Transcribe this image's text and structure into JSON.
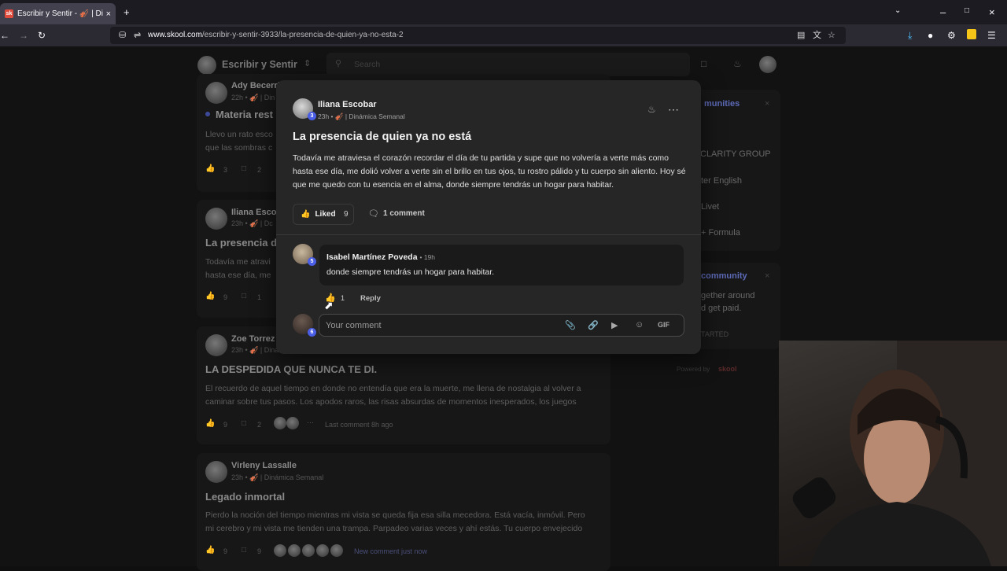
{
  "browser": {
    "tab_title": "Escribir y Sentir - 🎻 | Dinámica",
    "tab_close": "×",
    "new_tab": "+",
    "url_domain": "www.skool.com",
    "url_path": "/escribir-y-sentir-3933/la-presencia-de-quien-ya-no-esta-2"
  },
  "background": {
    "community_name": "Escribir y Sentir",
    "search_placeholder": "Search",
    "posts": [
      {
        "author": "Ady Becerri",
        "meta": "22h • 🎻 | Din",
        "title": "Materia rest",
        "body1": "Llevo un rato esco",
        "body2": "que las sombras c",
        "likes": "3",
        "comments": "2"
      },
      {
        "author": "Iliana Escob",
        "meta": "23h • 🎻 | Dc",
        "title": "La presencia d",
        "body1": "Todavía me atravi",
        "body2": "hasta ese día, me",
        "likes": "9",
        "comments": "1"
      },
      {
        "author": "Zoe Torrez",
        "meta": "23h • 🎻 | Dinámica Semanal",
        "title": "LA DESPEDIDA QUE NUNCA TE DI.",
        "body1": "El recuerdo de aquel tiempo en donde no entendía que era la muerte, me llena de nostalgia al volver a",
        "body2": "caminar sobre tus pasos. Los apodos raros, las risas absurdas de momentos inesperados, los juegos",
        "likes": "9",
        "comments": "2",
        "last": "Last comment 8h ago"
      },
      {
        "author": "Virleny Lassalle",
        "meta": "23h • 🎻 | Dinámica Semanal",
        "title": "Legado inmortal",
        "body1": "Pierdo la noción del tiempo mientras mi vista se queda fija esa silla mecedora. Está vacía, inmóvil. Pero",
        "body2": "mi cerebro y mi vista me tienden una trampa. Parpadeo varias veces y ahí estás. Tu cuerpo envejecido",
        "likes": "9",
        "comments": "9",
        "last": "New comment just now"
      }
    ],
    "sidebar": {
      "heading1": "munities",
      "items": [
        "CLARITY GROUP",
        "ter English",
        "Livet",
        "+ Formula"
      ],
      "heading2": "community",
      "text1": "gether around",
      "text2": "d get paid.",
      "cta": "TARTED",
      "powered": "Powered by"
    }
  },
  "modal": {
    "author": "Iliana Escobar",
    "author_level": "3",
    "meta": "23h • 🎻 | Dinámica Semanal",
    "title": "La presencia de quien ya no está",
    "body": "Todavía me atraviesa el corazón recordar el día de tu partida y supe que no volvería a verte más como hasta ese día, me dolió volver a verte sin el brillo en tus ojos, tu rostro pálido y tu cuerpo sin aliento. Hoy sé que me quedo con tu esencia en el alma, donde siempre tendrás un hogar para habitar.",
    "like_label": "Liked",
    "like_count": "9",
    "comment_count_label": "1 comment",
    "comment": {
      "author": "Isabel Martínez Poveda",
      "level": "5",
      "time": "19h",
      "text": "donde siempre tendrás un hogar para habitar.",
      "likes": "1",
      "reply_label": "Reply"
    },
    "input": {
      "placeholder": "Your comment",
      "user_level": "6",
      "gif_label": "GIF"
    }
  },
  "colors": {
    "modal_bg": "#262626",
    "level_badge": "#4b5ee6",
    "page_bg": "#121212"
  },
  "icons": [
    "bell-icon",
    "more-icon",
    "thumbs-up-icon",
    "comment-icon",
    "attach-icon",
    "link-icon",
    "youtube-icon",
    "emoji-icon"
  ]
}
